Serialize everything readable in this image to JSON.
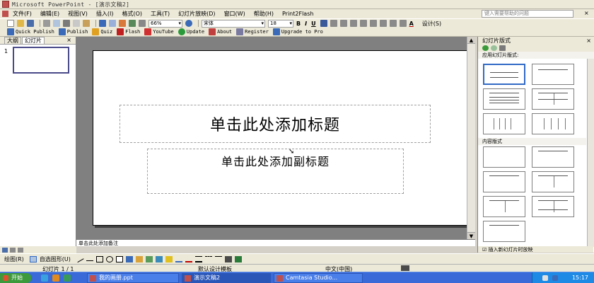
{
  "window": {
    "title": "Microsoft PowerPoint - [演示文稿2]"
  },
  "menu": {
    "items": [
      "文件(F)",
      "编辑(E)",
      "视图(V)",
      "插入(I)",
      "格式(O)",
      "工具(T)",
      "幻灯片放映(D)",
      "窗口(W)",
      "帮助(H)",
      "Print2Flash"
    ],
    "help_placeholder": "键入需要帮助的问题",
    "close": "×"
  },
  "toolbar": {
    "zoom": "66%",
    "font": "宋体",
    "font_size": "18",
    "bold": "B",
    "italic": "I",
    "underline": "U",
    "font_color": "A",
    "design": "设计(S)"
  },
  "plugin_toolbar": {
    "buttons": [
      "Quick Publish",
      "Publish",
      "Quiz",
      "Flash",
      "YouTube",
      "Update",
      "About",
      "Register",
      "Upgrade to Pro"
    ]
  },
  "left_pane": {
    "tabs": [
      "大纲",
      "幻灯片"
    ],
    "close": "×",
    "slide_number": "1"
  },
  "slide": {
    "title_placeholder": "单击此处添加标题",
    "subtitle_placeholder": "单击此处添加副标题"
  },
  "notes": {
    "placeholder": "单击此处添加备注"
  },
  "task_pane": {
    "title": "幻灯片版式",
    "close": "×",
    "apply_label": "应用幻灯片版式:",
    "content_label": "内容版式",
    "footer": "插入新幻灯片时放映"
  },
  "drawing_toolbar": {
    "draw": "绘图(R)",
    "autoshapes": "自选图形(U)"
  },
  "status_bar": {
    "slide": "幻灯片 1 / 1",
    "design": "默认设计模板",
    "language": "中文(中国)"
  },
  "taskbar": {
    "start": "开始",
    "tasks": [
      "我的画册.ppt",
      "演示文稿2",
      "Camtasia Studio..."
    ],
    "clock": "15:17"
  }
}
